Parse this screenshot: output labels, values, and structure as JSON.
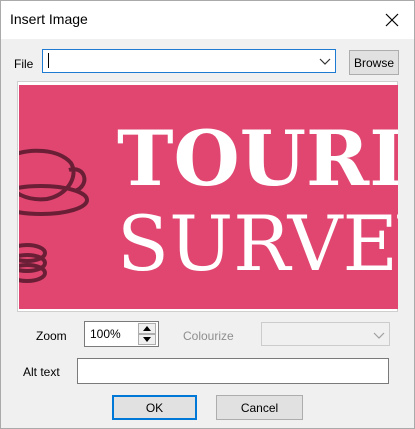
{
  "window": {
    "title": "Insert Image"
  },
  "file": {
    "label": "File",
    "value": "",
    "browse_label": "Browse"
  },
  "preview": {
    "background_color": "#e04670",
    "graphic_color": "#6b1f37",
    "text_color": "#ffffff",
    "line1": "TOURIS",
    "line2": "SURVEY"
  },
  "zoom": {
    "label": "Zoom",
    "value": "100%"
  },
  "colourize": {
    "label": "Colourize",
    "selected": ""
  },
  "alt_text": {
    "label": "Alt text",
    "value": ""
  },
  "buttons": {
    "ok_label": "OK",
    "cancel_label": "Cancel"
  },
  "icons": {
    "close": "close-icon",
    "dropdown": "chevron-down-icon",
    "spin_up": "triangle-up-icon",
    "spin_down": "triangle-down-icon"
  }
}
